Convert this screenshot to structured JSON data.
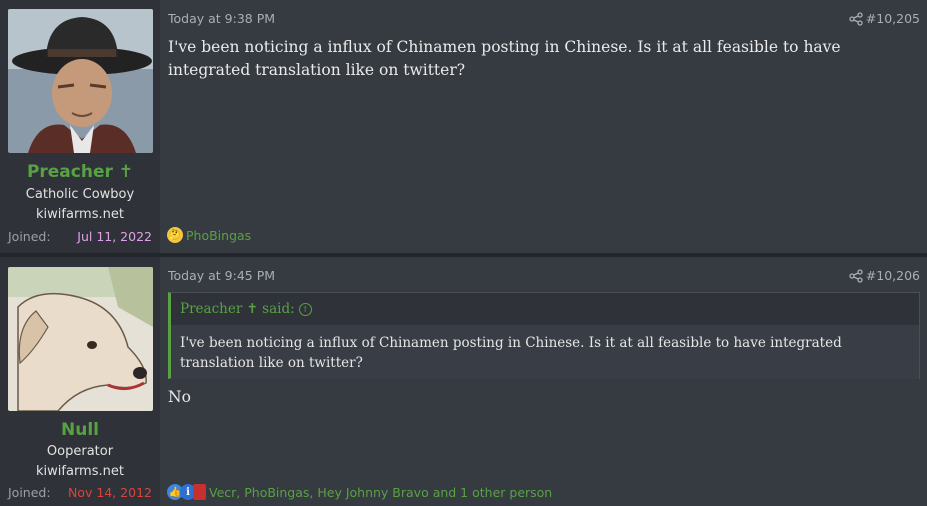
{
  "posts": [
    {
      "user": {
        "name": "Preacher ✝",
        "title": "Catholic Cowboy",
        "site": "kiwifarms.net",
        "joined_label": "Joined:",
        "joined_date": "Jul 11, 2022",
        "joined_color": "#e0a0e8"
      },
      "date": "Today at 9:38 PM",
      "number": "#10,205",
      "body": "I've been noticing a influx of Chinamen posting in Chinese. Is it at all feasible to have integrated translation like on twitter?",
      "reactions": {
        "icon": "thinking-face-icon",
        "names": "PhoBingas"
      }
    },
    {
      "user": {
        "name": "Null",
        "title": "Ooperator",
        "site": "kiwifarms.net",
        "joined_label": "Joined:",
        "joined_date": "Nov 14, 2012",
        "joined_color": "#d9443c"
      },
      "date": "Today at 9:45 PM",
      "number": "#10,206",
      "quote": {
        "author": "Preacher ✝ said:",
        "text": "I've been noticing a influx of Chinamen posting in Chinese. Is it at all feasible to have integrated translation like on twitter?"
      },
      "body": "No",
      "reactions": {
        "icons": [
          "thumbs-up-icon",
          "informative-icon",
          "red-flag-icon"
        ],
        "names": "Vecr, PhoBingas, Hey Johnny Bravo and 1 other person"
      }
    }
  ],
  "colors": {
    "username": "#58a244",
    "accent": "#58a244",
    "background": "#363a41",
    "sidebar": "#2f3238"
  }
}
